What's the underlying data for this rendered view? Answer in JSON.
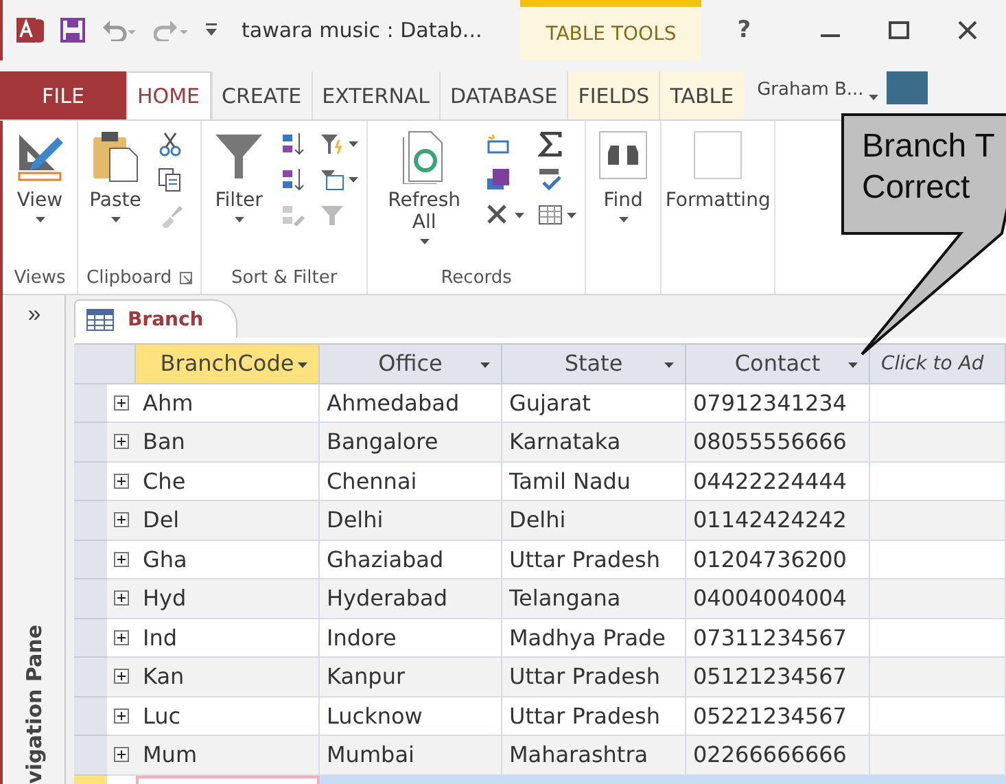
{
  "window": {
    "title": "tawara music : Datab...",
    "contextual_tab_group": "TABLE TOOLS",
    "help": "?",
    "user": "Graham B..."
  },
  "ribbon_tabs": [
    {
      "label": "FILE",
      "kind": "file",
      "selected": false
    },
    {
      "label": "HOME",
      "kind": "normal",
      "selected": true
    },
    {
      "label": "CREATE",
      "kind": "normal",
      "selected": false
    },
    {
      "label": "EXTERNAL",
      "kind": "normal",
      "selected": false
    },
    {
      "label": "DATABASE",
      "kind": "normal",
      "selected": false
    },
    {
      "label": "FIELDS",
      "kind": "contextual",
      "selected": false
    },
    {
      "label": "TABLE",
      "kind": "contextual",
      "selected": false
    }
  ],
  "ribbon_groups": [
    {
      "label": "Views",
      "launcher": false,
      "buttons": [
        "View"
      ]
    },
    {
      "label": "Clipboard",
      "launcher": true,
      "buttons": [
        "Paste"
      ]
    },
    {
      "label": "Sort & Filter",
      "launcher": false,
      "buttons": [
        "Filter"
      ]
    },
    {
      "label": "Records",
      "launcher": false,
      "buttons": [
        "Refresh All"
      ]
    },
    {
      "launcher": false,
      "buttons": [
        "Find"
      ]
    },
    {
      "launcher": false,
      "buttons": [
        "Formatting"
      ]
    }
  ],
  "navigation_pane": {
    "toggle": "»",
    "label": "vigation Pane"
  },
  "document_tab": {
    "label": "Branch"
  },
  "table": {
    "columns": [
      {
        "label": "BranchCode",
        "selected": true
      },
      {
        "label": "Office",
        "selected": false
      },
      {
        "label": "State",
        "selected": false
      },
      {
        "label": "Contact",
        "selected": false
      },
      {
        "label": "Click to Ad",
        "selected": false
      }
    ],
    "rows": [
      [
        "Ahm",
        "Ahmedabad",
        "Gujarat",
        "07912341234"
      ],
      [
        "Ban",
        "Bangalore",
        "Karnataka",
        "08055556666"
      ],
      [
        "Che",
        "Chennai",
        "Tamil Nadu",
        "04422224444"
      ],
      [
        "Del",
        "Delhi",
        "Delhi",
        "01142424242"
      ],
      [
        "Gha",
        "Ghaziabad",
        "Uttar Pradesh",
        "01204736200"
      ],
      [
        "Hyd",
        "Hyderabad",
        "Telangana",
        "04004004004"
      ],
      [
        "Ind",
        "Indore",
        "Madhya Prade",
        "07311234567"
      ],
      [
        "Kan",
        "Kanpur",
        "Uttar Pradesh",
        "05121234567"
      ],
      [
        "Luc",
        "Lucknow",
        "Uttar Pradesh",
        "05221234567"
      ],
      [
        "Mum",
        "Mumbai",
        "Maharashtra",
        "02266666666"
      ]
    ]
  },
  "callout": {
    "lines": [
      "Branch T",
      "Correct"
    ]
  }
}
